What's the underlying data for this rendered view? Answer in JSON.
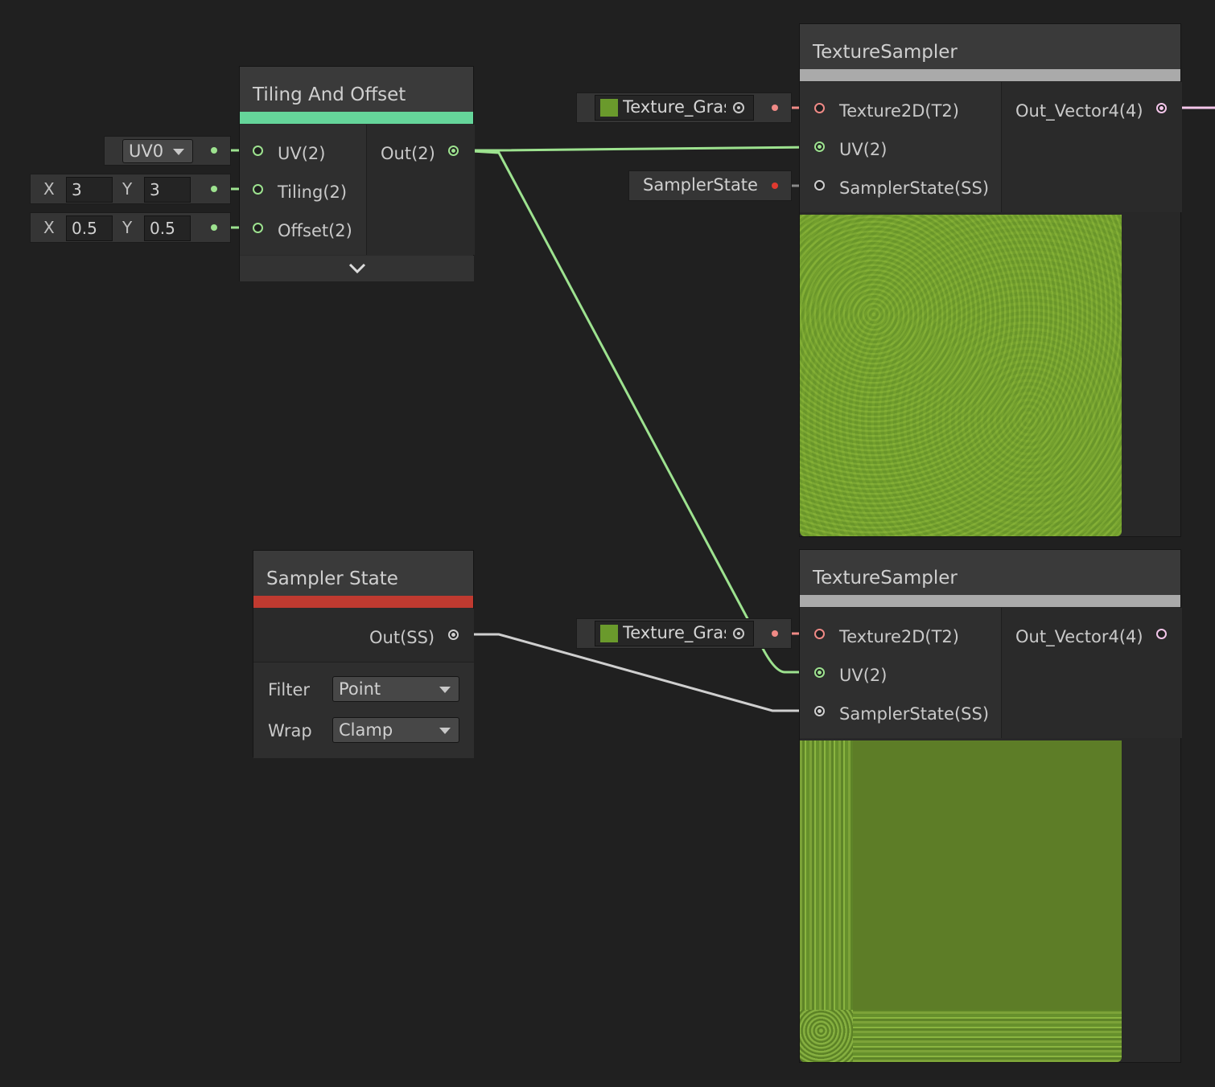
{
  "tiling_node": {
    "title": "Tiling And Offset",
    "accent": "#65d59a",
    "inputs": [
      "UV(2)",
      "Tiling(2)",
      "Offset(2)"
    ],
    "output": "Out(2)",
    "uv_channel": "UV0",
    "tiling": {
      "x_label": "X",
      "x": "3",
      "y_label": "Y",
      "y": "3"
    },
    "offset": {
      "x_label": "X",
      "x": "0.5",
      "y_label": "Y",
      "y": "0.5"
    }
  },
  "sampler_node": {
    "title": "Sampler State",
    "accent": "#c03a30",
    "output": "Out(SS)",
    "filter_label": "Filter",
    "filter_value": "Point",
    "wrap_label": "Wrap",
    "wrap_value": "Clamp"
  },
  "texture_sampler_top": {
    "title": "TextureSampler",
    "inputs": [
      "Texture2D(T2)",
      "UV(2)",
      "SamplerState(SS)"
    ],
    "output": "Out_Vector4(4)",
    "texture_field": "Texture_Gras",
    "sampler_field": "SamplerState"
  },
  "texture_sampler_bottom": {
    "title": "TextureSampler",
    "inputs": [
      "Texture2D(T2)",
      "UV(2)",
      "SamplerState(SS)"
    ],
    "output": "Out_Vector4(4)",
    "texture_field": "Texture_Gras"
  },
  "colors": {
    "vector2": "#9de28f",
    "texture": "#f08a86",
    "sampler": "#d0d0d0",
    "vector4": "#f4c6ea",
    "grass": "#6a9a2c"
  }
}
